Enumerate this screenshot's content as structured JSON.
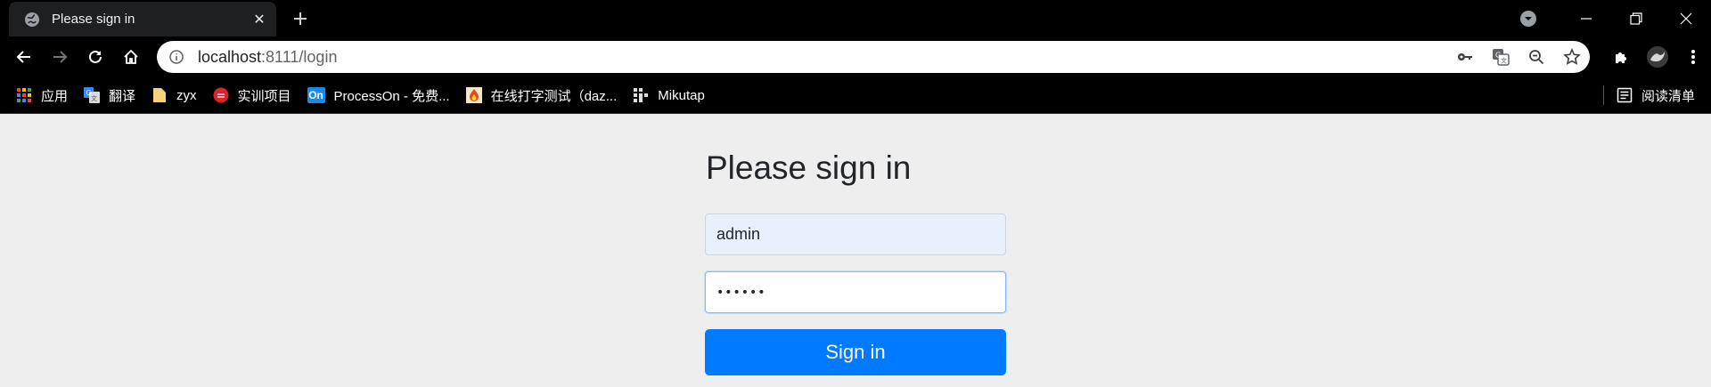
{
  "browser": {
    "tab": {
      "title": "Please sign in",
      "close_glyph": "✕"
    },
    "newtab_glyph": "+",
    "address": {
      "host": "localhost",
      "rest": ":8111/login"
    },
    "bookmarks": [
      {
        "label": "应用",
        "icon": "apps-grid-icon"
      },
      {
        "label": "翻译",
        "icon": "google-translate-icon"
      },
      {
        "label": "zyx",
        "icon": "folder-icon"
      },
      {
        "label": "实训项目",
        "icon": "red-circle-icon"
      },
      {
        "label": "ProcessOn - 免费...",
        "icon": "processon-icon",
        "badge": "On"
      },
      {
        "label": "在线打字测试（daz...",
        "icon": "flame-icon"
      },
      {
        "label": "Mikutap",
        "icon": "mikutap-icon"
      }
    ],
    "reading_list": {
      "label": "阅读清单",
      "icon": "reading-list-icon"
    },
    "colors": {
      "chrome": "#000000",
      "omnibox": "#ffffff",
      "accent": "#007bff"
    }
  },
  "page": {
    "heading": "Please sign in",
    "username_value": "admin",
    "password_value": "••••••",
    "submit_label": "Sign in"
  }
}
